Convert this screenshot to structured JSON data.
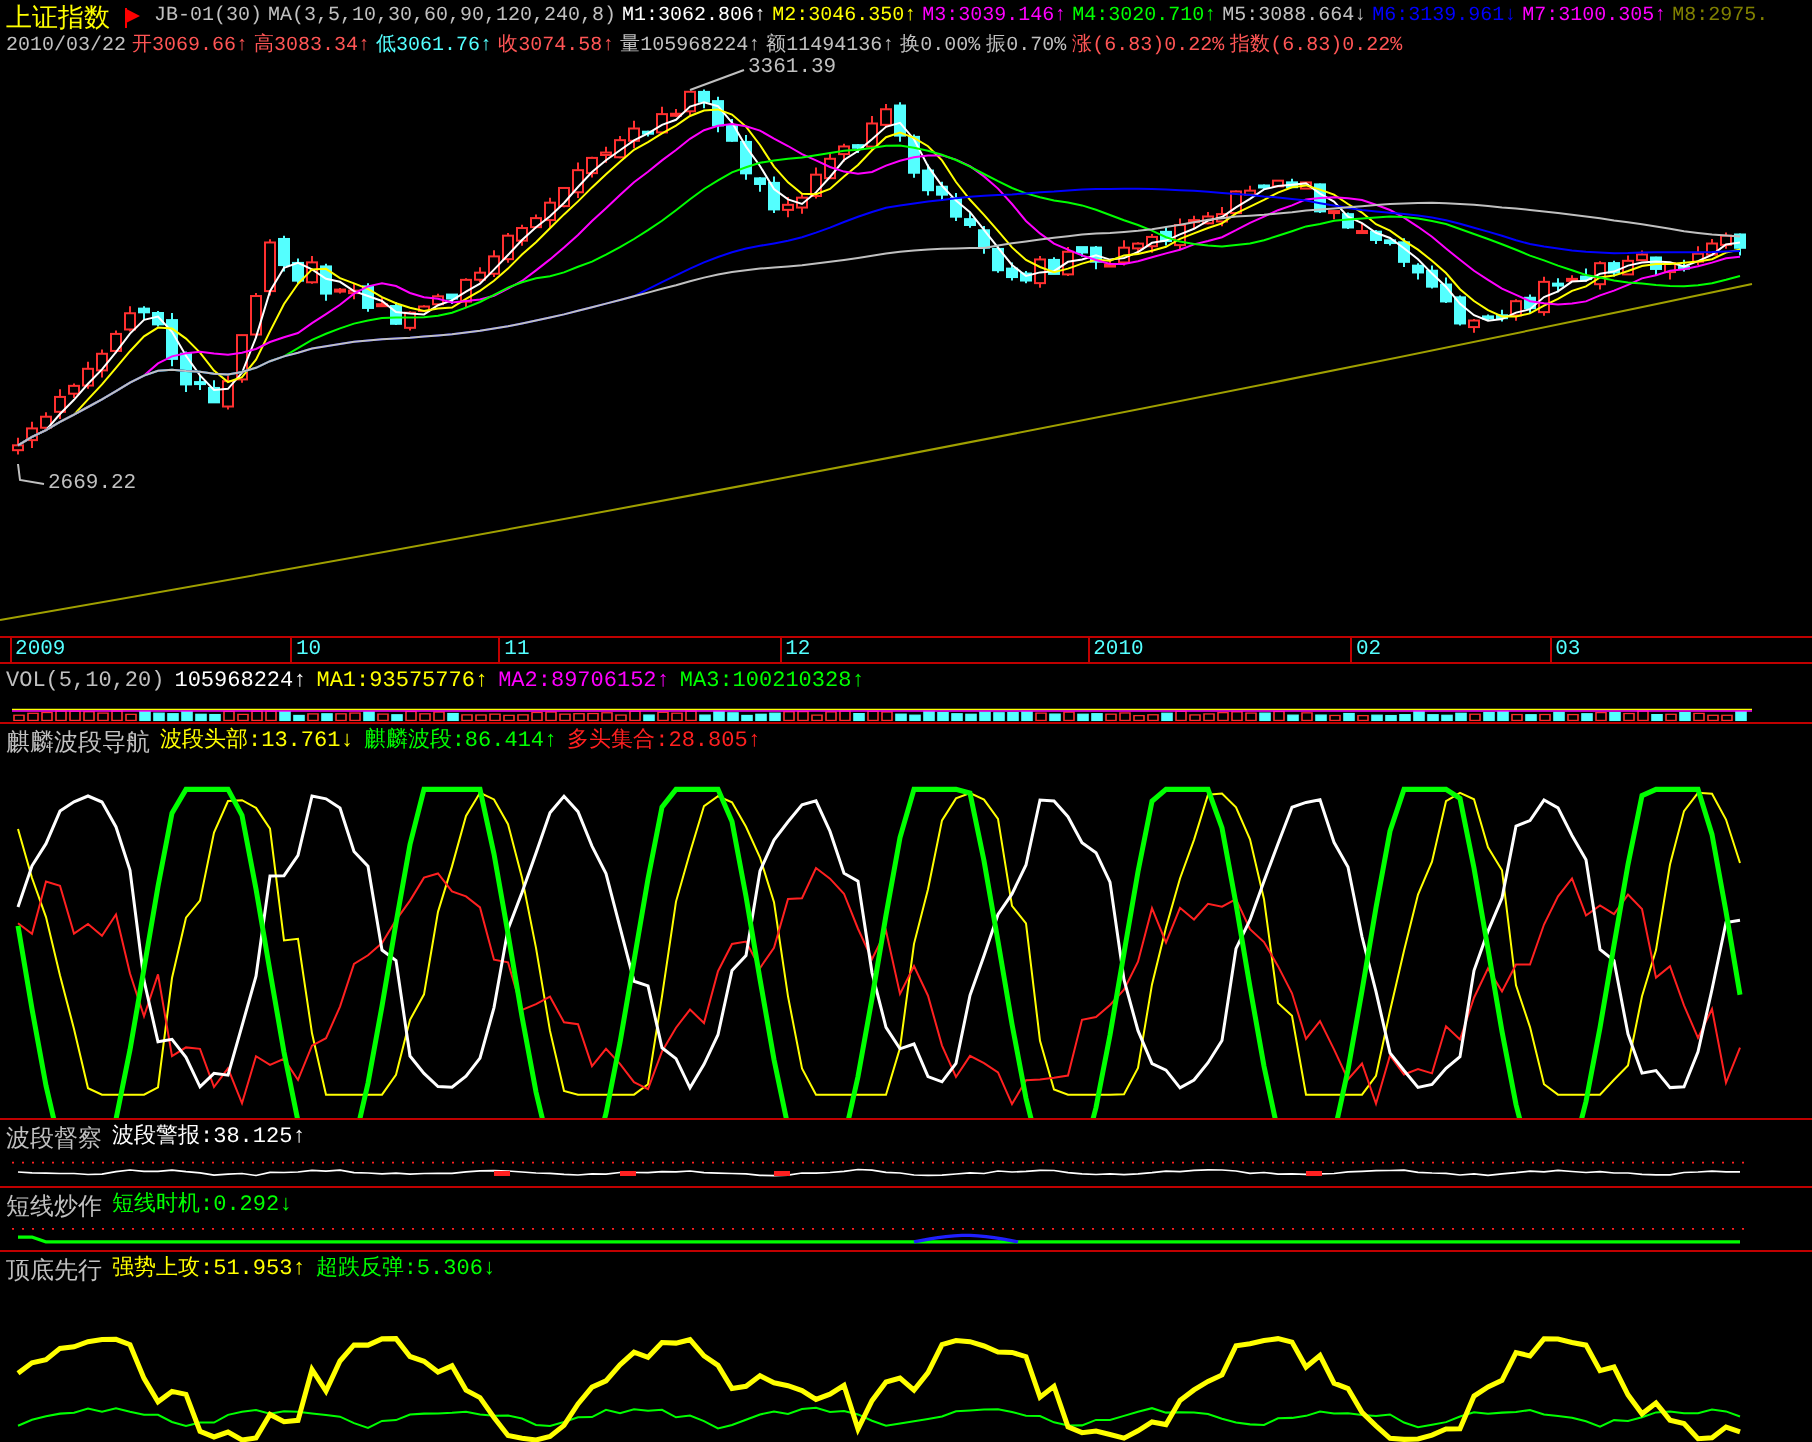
{
  "header": {
    "title": "上证指数",
    "line1": [
      {
        "text": "JB-01(30)",
        "color": "#c0c0c0"
      },
      {
        "text": "MA(3,5,10,30,60,90,120,240,8)",
        "color": "#c0c0c0"
      },
      {
        "text": "M1:3062.806↑",
        "color": "#ffffff"
      },
      {
        "text": "M2:3046.350↑",
        "color": "#ffff00"
      },
      {
        "text": "M3:3039.146↑",
        "color": "#ff00ff"
      },
      {
        "text": "M4:3020.710↑",
        "color": "#00ff00"
      },
      {
        "text": "M5:3088.664↓",
        "color": "#c0c0c0"
      },
      {
        "text": "M6:3139.961↓",
        "color": "#0000ff"
      },
      {
        "text": "M7:3100.305↑",
        "color": "#ff00ff"
      },
      {
        "text": "M8:2975.",
        "color": "#808000"
      }
    ],
    "line2": [
      {
        "text": "2010/03/22",
        "color": "#c0c0c0"
      },
      {
        "text": "开3069.66↑",
        "color": "#ff5555"
      },
      {
        "text": "高3083.34↑",
        "color": "#ff5555"
      },
      {
        "text": "低3061.76↑",
        "color": "#54ffff"
      },
      {
        "text": "收3074.58↑",
        "color": "#ff5555"
      },
      {
        "text": "量105968224↑",
        "color": "#c0c0c0"
      },
      {
        "text": "额11494136↑",
        "color": "#c0c0c0"
      },
      {
        "text": "换0.00%",
        "color": "#c0c0c0"
      },
      {
        "text": "振0.70%",
        "color": "#c0c0c0"
      },
      {
        "text": "涨(6.83)0.22%",
        "color": "#ff5555"
      },
      {
        "text": "指数(6.83)0.22%",
        "color": "#ff5555"
      }
    ]
  },
  "chart": {
    "high_label": "3361.39",
    "low_label": "2669.22"
  },
  "time_axis": [
    "2009",
    "10",
    "11",
    "12",
    "2010",
    "02",
    "03"
  ],
  "volume": {
    "items": [
      {
        "text": "VOL(5,10,20)",
        "color": "#c0c0c0"
      },
      {
        "text": "105968224↑",
        "color": "#ffffff"
      },
      {
        "text": "MA1:93575776↑",
        "color": "#ffff00"
      },
      {
        "text": "MA2:89706152↑",
        "color": "#ff00ff"
      },
      {
        "text": "MA3:100210328↑",
        "color": "#00ff00"
      }
    ]
  },
  "panels": [
    {
      "kind": "wave",
      "title": "麒麟波段导航",
      "items": [
        {
          "text": "波段头部:13.761↓",
          "color": "#ffff00"
        },
        {
          "text": "麒麟波段:86.414↑",
          "color": "#00ff00"
        },
        {
          "text": "多头集合:28.805↑",
          "color": "#ff2020"
        }
      ]
    },
    {
      "kind": "alert",
      "title": "波段督察",
      "items": [
        {
          "text": "波段警报:38.125↑",
          "color": "#ffffff"
        }
      ]
    },
    {
      "kind": "timing",
      "title": "短线炒作",
      "items": [
        {
          "text": "短线时机:0.292↓",
          "color": "#00ff00"
        }
      ]
    },
    {
      "kind": "trend",
      "title": "顶底先行",
      "items": [
        {
          "text": "强势上攻:51.953↑",
          "color": "#ffff00"
        },
        {
          "text": "超跌反弹:5.306↓",
          "color": "#00ff00"
        }
      ]
    }
  ]
}
